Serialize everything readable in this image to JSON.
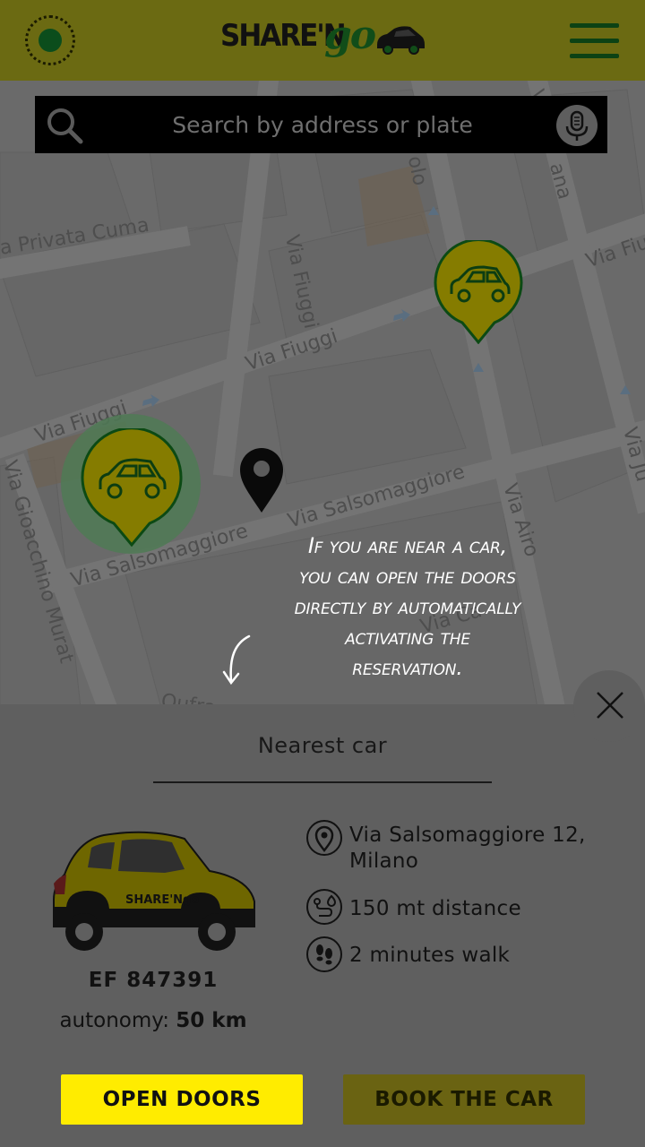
{
  "header": {
    "logo_text_1": "SHARE'N",
    "logo_text_2": "go"
  },
  "search": {
    "placeholder": "Search by address or plate"
  },
  "map": {
    "streets": [
      "a Privata Cuma",
      "Via Fiuggi",
      "Via Fiuggi",
      "Via Fiuggi",
      "Via Fiu",
      "Via Salsomaggiore",
      "Via Salsomaggiore",
      "Via Gioacchino Murat",
      "Via Airo",
      "Via Ca",
      "olo",
      "ana",
      "Via",
      "Via Ju",
      "Oufra"
    ]
  },
  "tooltip": {
    "lines": [
      "If you are near a car,",
      "you can open the doors",
      "directly by automatically",
      "activating the",
      "reservation."
    ]
  },
  "sheet": {
    "title": "Nearest car",
    "plate": "EF 847391",
    "autonomy_label": "autonomy:",
    "autonomy_value": "50 km",
    "address": "Via Salsomaggiore 12, Milano",
    "distance": "150 mt distance",
    "walk": "2 minutes walk",
    "open_doors": "OPEN DOORS",
    "book_car": "BOOK THE CAR",
    "car_logo_text": "SHARE'Ngo"
  },
  "colors": {
    "header_bg": "#6b6a12",
    "brand_yellow": "#ffec00",
    "brand_green": "#114d19",
    "marker_fill": "#8a7f00",
    "sheet_bg": "#5f5f5f"
  }
}
